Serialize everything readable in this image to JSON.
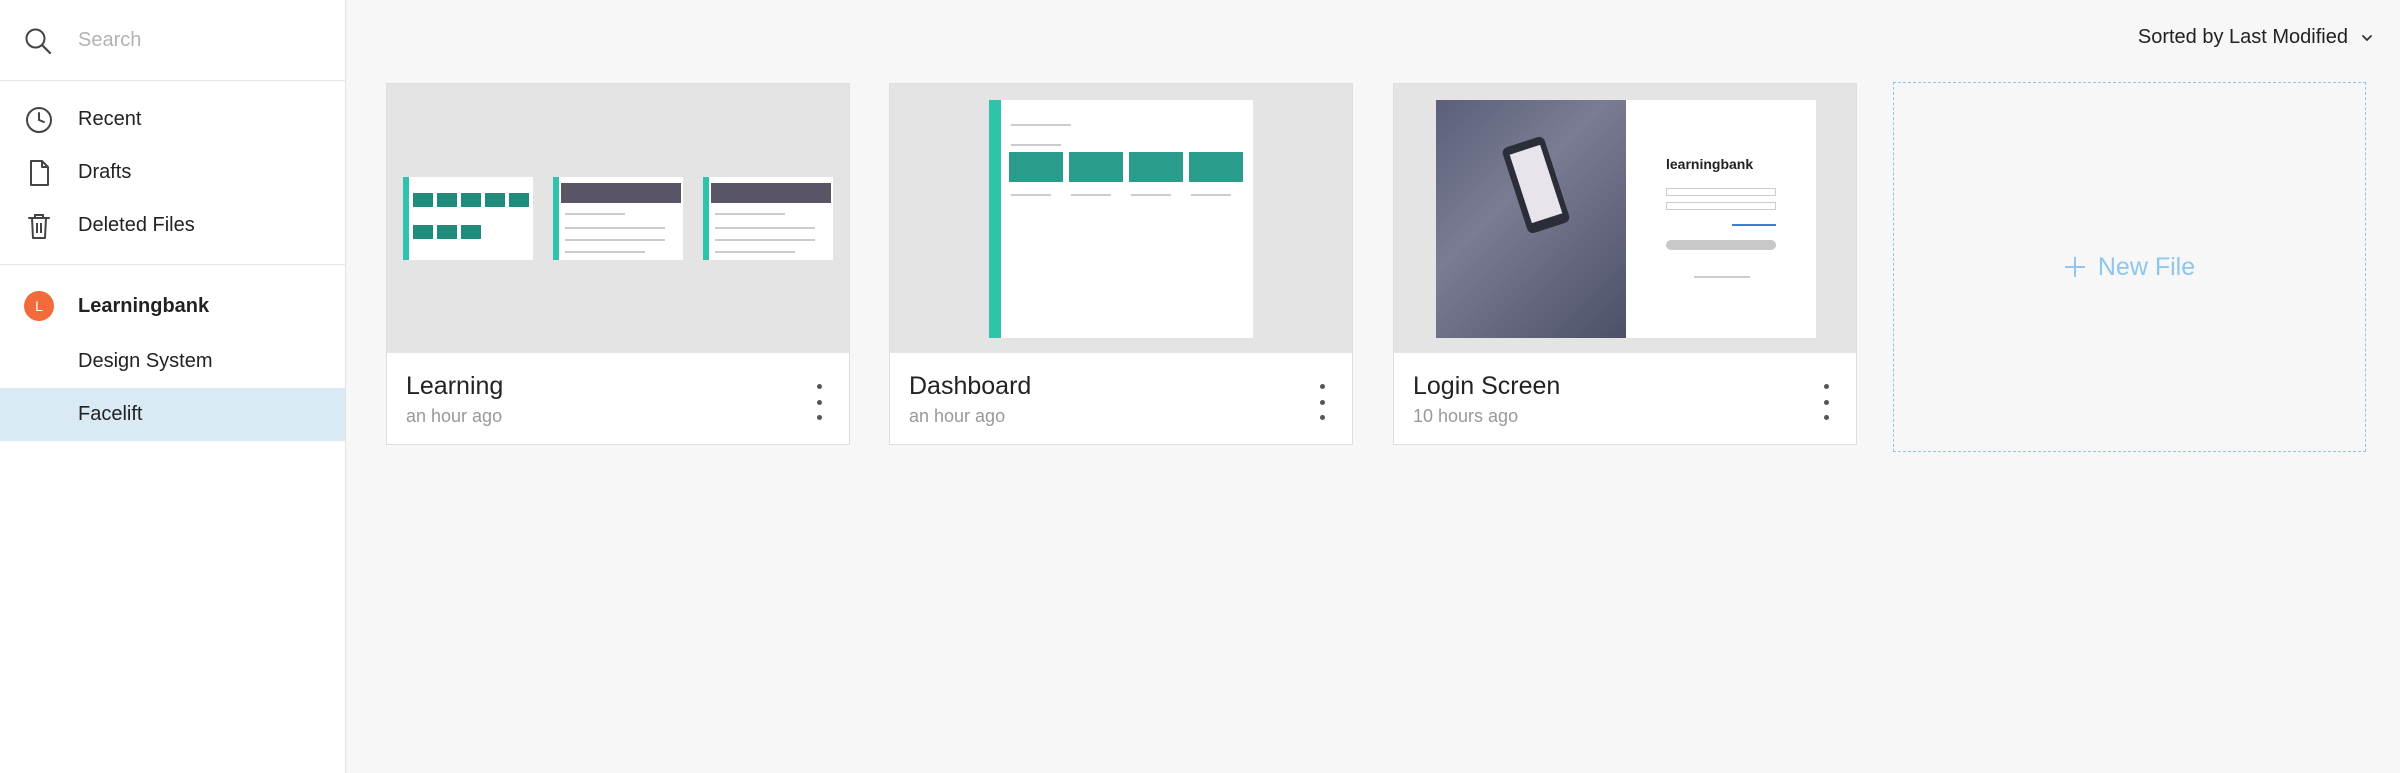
{
  "search": {
    "placeholder": "Search"
  },
  "nav": {
    "items": [
      {
        "label": "Recent",
        "icon": "clock-icon"
      },
      {
        "label": "Drafts",
        "icon": "document-icon"
      },
      {
        "label": "Deleted Files",
        "icon": "trash-icon"
      }
    ]
  },
  "team": {
    "initial": "L",
    "name": "Learningbank",
    "avatar_color": "#f26b3a",
    "projects": [
      {
        "label": "Design System",
        "active": false
      },
      {
        "label": "Facelift",
        "active": true
      }
    ]
  },
  "sort": {
    "label": "Sorted by Last Modified"
  },
  "files": [
    {
      "name": "Learning",
      "time": "an hour ago"
    },
    {
      "name": "Dashboard",
      "time": "an hour ago"
    },
    {
      "name": "Login Screen",
      "time": "10 hours ago"
    }
  ],
  "login_preview": {
    "brand": "learningbank"
  },
  "new_file": {
    "label": "New File"
  },
  "colors": {
    "accent": "#8ec6ee",
    "active_bg": "#daeaf5",
    "teal": "#2ec4ab"
  }
}
